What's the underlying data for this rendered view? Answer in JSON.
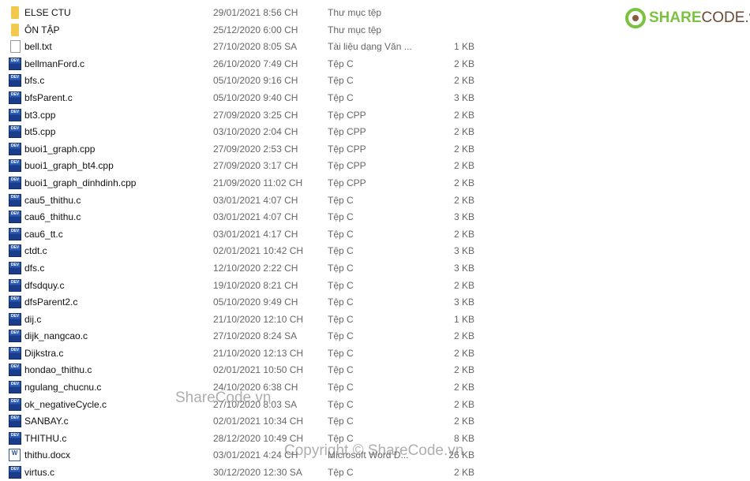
{
  "files": [
    {
      "name": "ELSE CTU",
      "date": "29/01/2021 8:56 CH",
      "type": "Thư mục tệp",
      "size": "",
      "icon": "folder"
    },
    {
      "name": "ÔN TẬP",
      "date": "25/12/2020 6:00 CH",
      "type": "Thư mục tệp",
      "size": "",
      "icon": "folder"
    },
    {
      "name": "bell.txt",
      "date": "27/10/2020 8:05 SA",
      "type": "Tài liệu dạng Văn ...",
      "size": "1 KB",
      "icon": "txt"
    },
    {
      "name": "bellmanFord.c",
      "date": "26/10/2020 7:49 CH",
      "type": "Tệp C",
      "size": "2 KB",
      "icon": "dev"
    },
    {
      "name": "bfs.c",
      "date": "05/10/2020 9:16 CH",
      "type": "Tệp C",
      "size": "2 KB",
      "icon": "dev"
    },
    {
      "name": "bfsParent.c",
      "date": "05/10/2020 9:40 CH",
      "type": "Tệp C",
      "size": "3 KB",
      "icon": "dev"
    },
    {
      "name": "bt3.cpp",
      "date": "27/09/2020 3:25 CH",
      "type": "Tệp CPP",
      "size": "2 KB",
      "icon": "dev"
    },
    {
      "name": "bt5.cpp",
      "date": "03/10/2020 2:04 CH",
      "type": "Tệp CPP",
      "size": "2 KB",
      "icon": "dev"
    },
    {
      "name": "buoi1_graph.cpp",
      "date": "27/09/2020 2:53 CH",
      "type": "Tệp CPP",
      "size": "2 KB",
      "icon": "dev"
    },
    {
      "name": "buoi1_graph_bt4.cpp",
      "date": "27/09/2020 3:17 CH",
      "type": "Tệp CPP",
      "size": "2 KB",
      "icon": "dev"
    },
    {
      "name": "buoi1_graph_dinhdinh.cpp",
      "date": "21/09/2020 11:02 CH",
      "type": "Tệp CPP",
      "size": "2 KB",
      "icon": "dev"
    },
    {
      "name": "cau5_thithu.c",
      "date": "03/01/2021 4:07 CH",
      "type": "Tệp C",
      "size": "2 KB",
      "icon": "dev"
    },
    {
      "name": "cau6_thithu.c",
      "date": "03/01/2021 4:07 CH",
      "type": "Tệp C",
      "size": "3 KB",
      "icon": "dev"
    },
    {
      "name": "cau6_tt.c",
      "date": "03/01/2021 4:17 CH",
      "type": "Tệp C",
      "size": "2 KB",
      "icon": "dev"
    },
    {
      "name": "ctdt.c",
      "date": "02/01/2021 10:42 CH",
      "type": "Tệp C",
      "size": "3 KB",
      "icon": "dev"
    },
    {
      "name": "dfs.c",
      "date": "12/10/2020 2:22 CH",
      "type": "Tệp C",
      "size": "3 KB",
      "icon": "dev"
    },
    {
      "name": "dfsdquy.c",
      "date": "19/10/2020 8:21 CH",
      "type": "Tệp C",
      "size": "2 KB",
      "icon": "dev"
    },
    {
      "name": "dfsParent2.c",
      "date": "05/10/2020 9:49 CH",
      "type": "Tệp C",
      "size": "3 KB",
      "icon": "dev"
    },
    {
      "name": "dij.c",
      "date": "21/10/2020 12:10 CH",
      "type": "Tệp C",
      "size": "1 KB",
      "icon": "dev"
    },
    {
      "name": "dijk_nangcao.c",
      "date": "27/10/2020 8:24 SA",
      "type": "Tệp C",
      "size": "2 KB",
      "icon": "dev"
    },
    {
      "name": "Dijkstra.c",
      "date": "21/10/2020 12:13 CH",
      "type": "Tệp C",
      "size": "2 KB",
      "icon": "dev"
    },
    {
      "name": "hondao_thithu.c",
      "date": "02/01/2021 10:50 CH",
      "type": "Tệp C",
      "size": "2 KB",
      "icon": "dev"
    },
    {
      "name": "ngulang_chucnu.c",
      "date": "24/10/2020 6:38 CH",
      "type": "Tệp C",
      "size": "2 KB",
      "icon": "dev"
    },
    {
      "name": "ok_negativeCycle.c",
      "date": "27/10/2020 8:03 SA",
      "type": "Tệp C",
      "size": "2 KB",
      "icon": "dev"
    },
    {
      "name": "SANBAY.c",
      "date": "02/01/2021 10:34 CH",
      "type": "Tệp C",
      "size": "2 KB",
      "icon": "dev"
    },
    {
      "name": "THITHU.c",
      "date": "28/12/2020 10:49 CH",
      "type": "Tệp C",
      "size": "8 KB",
      "icon": "dev"
    },
    {
      "name": "thithu.docx",
      "date": "03/01/2021 4:24 CH",
      "type": "Microsoft Word D...",
      "size": "26 KB",
      "icon": "word"
    },
    {
      "name": "virtus.c",
      "date": "30/12/2020 12:30 SA",
      "type": "Tệp C",
      "size": "2 KB",
      "icon": "dev"
    }
  ],
  "logo": {
    "part1": "SHARE",
    "part2": "CODE.vn"
  },
  "watermarks": {
    "center": "ShareCode.vn",
    "copyright": "Copyright © ShareCode.vn"
  }
}
